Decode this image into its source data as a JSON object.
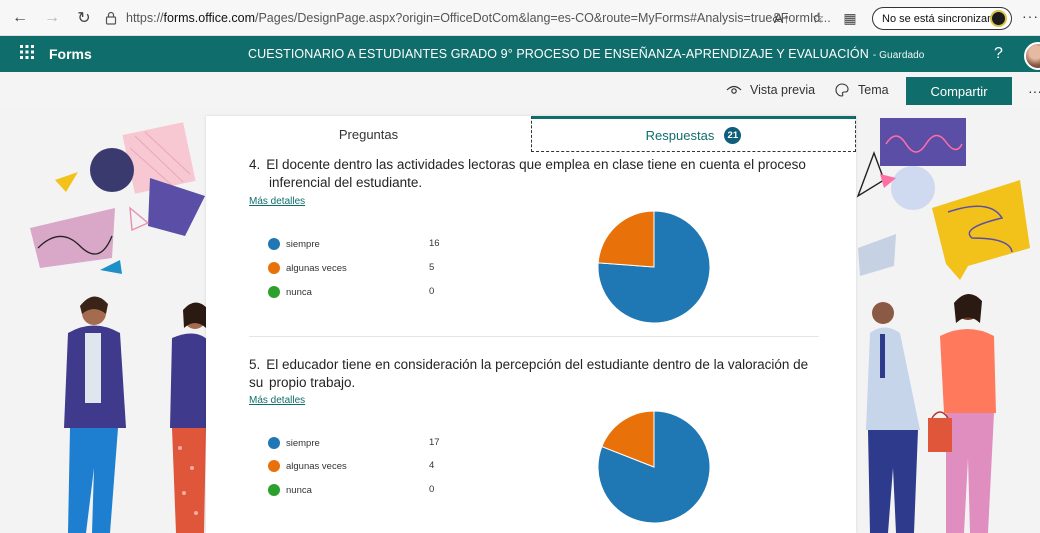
{
  "browser": {
    "url_prefix": "https://",
    "url_host": "forms.office.com",
    "url_rest": "/Pages/DesignPage.aspx?origin=OfficeDotCom&lang=es-CO&route=MyForms#Analysis=true&FormId...",
    "sync_label": "No se está sincronizando"
  },
  "header": {
    "brand": "Forms",
    "title": "CUESTIONARIO A ESTUDIANTES GRADO 9° PROCESO DE ENSEÑANZA-APRENDIZAJE Y EVALUACIÓN",
    "saved": "- Guardado",
    "help": "?"
  },
  "toolbar": {
    "preview": "Vista previa",
    "theme": "Tema",
    "share": "Compartir"
  },
  "tabs": {
    "questions": "Preguntas",
    "responses": "Respuestas",
    "responses_count": "21"
  },
  "colors": {
    "accent": "#0f6e6b",
    "siempre": "#1f77b4",
    "algunas_veces": "#e8710a",
    "nunca": "#2ca02c"
  },
  "questions": [
    {
      "number": "4.",
      "text_line1": "El docente dentro las actividades lectoras que emplea en clase tiene en cuenta el proceso",
      "text_line2": "inferencial del estudiante.",
      "details": "Más detalles",
      "options": [
        {
          "label": "siempre",
          "count": "16"
        },
        {
          "label": "algunas veces",
          "count": "5"
        },
        {
          "label": "nunca",
          "count": "0"
        }
      ]
    },
    {
      "number": "5.",
      "text_line1": "El educador tiene en consideración la percepción del estudiante dentro de la valoración de su",
      "text_line2": "propio trabajo.",
      "details": "Más detalles",
      "options": [
        {
          "label": "siempre",
          "count": "17"
        },
        {
          "label": "algunas veces",
          "count": "4"
        },
        {
          "label": "nunca",
          "count": "0"
        }
      ]
    }
  ],
  "chart_data": [
    {
      "type": "pie",
      "categories": [
        "siempre",
        "algunas veces",
        "nunca"
      ],
      "values": [
        16,
        5,
        0
      ],
      "colors": [
        "#1f77b4",
        "#e8710a",
        "#2ca02c"
      ]
    },
    {
      "type": "pie",
      "categories": [
        "siempre",
        "algunas veces",
        "nunca"
      ],
      "values": [
        17,
        4,
        0
      ],
      "colors": [
        "#1f77b4",
        "#e8710a",
        "#2ca02c"
      ]
    }
  ]
}
